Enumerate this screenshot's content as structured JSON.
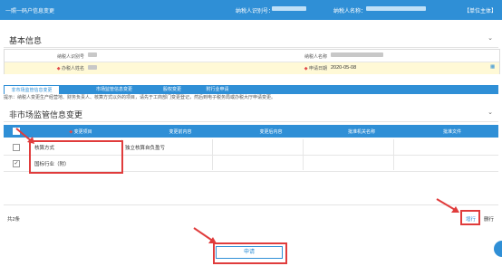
{
  "top_bar": {
    "app_title": "一照一码户信息变更",
    "taxpayer_id_label": "纳税人识别号：",
    "taxpayer_name_label": "纳税人名称：",
    "unit_identity": "【单位主体】"
  },
  "basic_info": {
    "title": "基本信息",
    "fields": {
      "taxpayer_id_label": "纳税人识别号",
      "taxpayer_name_label": "纳税人名称",
      "handler_label": "办税人姓名",
      "apply_date_label": "申请日期",
      "apply_date_value": "2020-05-08"
    }
  },
  "tabs": [
    {
      "label": "非市场监管信息变更",
      "active": true
    },
    {
      "label": "市场监管信息变更",
      "active": false
    },
    {
      "label": "股权变更",
      "active": false
    },
    {
      "label": "附行业申请",
      "active": false
    }
  ],
  "tip_text": "提示：纳税人变更生产经营地、财务负责人、核算方式以外的项目，请先于工商部门变更登记，然后到电子税务局或办税大厅申请变更。",
  "change_section": {
    "title": "非市场监管信息变更",
    "columns": [
      "变更项目",
      "变更前内容",
      "变更后内容",
      "批准机关名称",
      "批准文件"
    ],
    "rows": [
      {
        "item": "核算方式",
        "before": "独立核算自负盈亏",
        "after": "",
        "authority": "",
        "document": "",
        "checked": false
      },
      {
        "item": "国标行业（附）",
        "before": "",
        "after": "",
        "authority": "",
        "document": "",
        "checked": true
      }
    ],
    "total_text": "共2条",
    "add_row_label": "增行",
    "delete_row_label": "删行"
  },
  "apply_button_label": "申请",
  "colors": {
    "primary": "#2f8fd6",
    "highlight": "#e03c3c",
    "required": "#e24b4b"
  },
  "icons": {
    "calendar": "calendar-icon",
    "collapse": "chevron-down-icon"
  }
}
